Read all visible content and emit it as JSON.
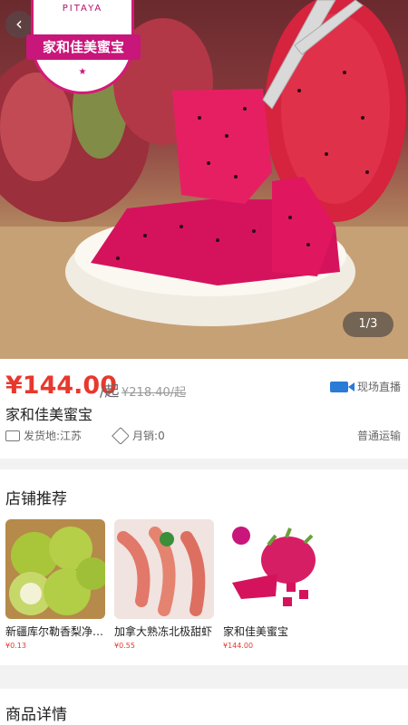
{
  "hero": {
    "page_indicator": "1/3",
    "logo": {
      "top_text": "PITAYA",
      "band_text": "家和佳美蜜宝",
      "star": "★"
    }
  },
  "product": {
    "price": "¥144.00",
    "price_unit": "/起",
    "original_price": "¥218.40/起",
    "live_label": "现场直播",
    "title": "家和佳美蜜宝",
    "ship_from": "发货地:江苏",
    "monthly_sales": "月销:0",
    "shipping": "普通运输"
  },
  "shop": {
    "title": "店铺推荐",
    "items": [
      {
        "name": "新疆库尔勒香梨净…",
        "price": "¥0.13"
      },
      {
        "name": "加拿大熟冻北极甜虾",
        "price": "¥0.55"
      },
      {
        "name": "家和佳美蜜宝",
        "price": "¥144.00"
      }
    ]
  },
  "detail": {
    "title": "商品详情"
  },
  "colors": {
    "price": "#e8382d",
    "brand": "#c8167a",
    "live": "#2a7bd6"
  }
}
